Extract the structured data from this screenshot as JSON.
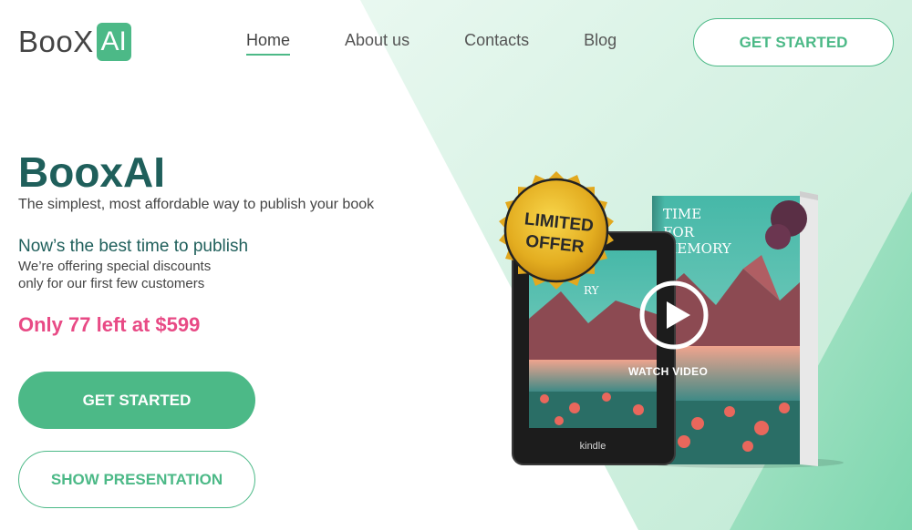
{
  "brand": {
    "name_part": "BooX",
    "badge": "AI"
  },
  "nav": {
    "items": [
      {
        "label": "Home",
        "active": true
      },
      {
        "label": "About us",
        "active": false
      },
      {
        "label": "Contacts",
        "active": false
      },
      {
        "label": "Blog",
        "active": false
      }
    ]
  },
  "header": {
    "cta_label": "GET STARTED"
  },
  "hero": {
    "title": "BooxAI",
    "subtitle": "The simplest, most affordable way to publish your book",
    "heading": "Now’s the best time to publish",
    "desc_line1": "We’re offering special discounts",
    "desc_line2": "only for our first few customers",
    "offer": "Only 77 left at $599",
    "primary_cta": "GET STARTED",
    "secondary_cta": "SHOW PRESENTATION"
  },
  "product": {
    "badge_line1": "LIMITED",
    "badge_line2": "OFFER",
    "book_title_line1": "TIME",
    "book_title_line2": "FOR",
    "book_title_line3": "MEMORY",
    "device_brand": "kindle",
    "device_screen_text": "RY",
    "watch_label": "WATCH VIDEO"
  },
  "colors": {
    "accent": "#4cb987",
    "title": "#1f5f5b",
    "offer": "#e84a85"
  }
}
